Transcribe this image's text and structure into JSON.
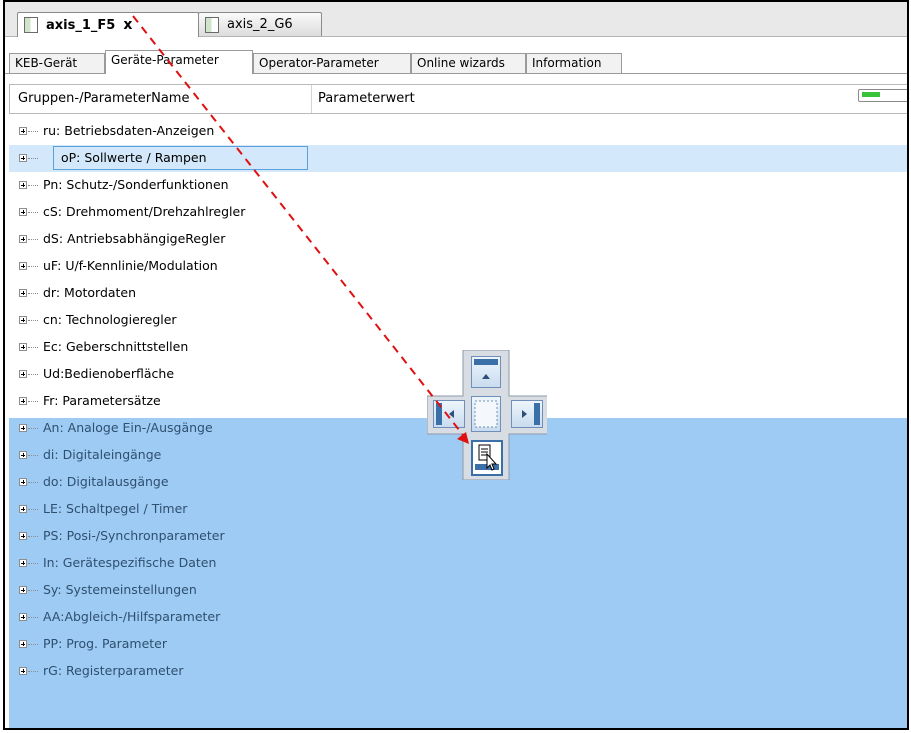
{
  "colors": {
    "accent": "#3a6fa8",
    "selected_row": "#d3e8fa",
    "drop_area": "#9ecbf4",
    "progress": "#39c339",
    "drag_arrow": "#e01010"
  },
  "doc_tabs": [
    {
      "title": "axis_1_F5",
      "close_label": "x",
      "active": true,
      "icon": "device-icon"
    },
    {
      "title": "axis_2_G6",
      "active": false,
      "icon": "device-icon"
    }
  ],
  "param_tabs": [
    "KEB-Gerät",
    "Geräte-Parameter",
    "Operator-Parameter",
    "Online wizards",
    "Information"
  ],
  "grid": {
    "col_name": "Gruppen-/ParameterName",
    "col_value": "Parameterwert",
    "progress_fraction": 0.4,
    "rows": [
      "ru: Betriebsdaten-Anzeigen",
      "oP: Sollwerte / Rampen",
      "Pn: Schutz-/Sonderfunktionen",
      "cS: Drehmoment/Drehzahlregler",
      "dS: AntriebsabhängigeRegler",
      "uF: U/f-Kennlinie/Modulation",
      "dr: Motordaten",
      "cn: Technologieregler",
      "Ec: Geberschnittstellen",
      "Ud:Bedienoberfläche",
      "Fr: Parametersätze",
      "An: Analoge Ein-/Ausgänge",
      "di: Digitaleingänge",
      "do: Digitalausgänge",
      "LE: Schaltpegel / Timer",
      "PS: Posi-/Synchronparameter",
      "In: Gerätespezifische Daten",
      "Sy: Systemeinstellungen",
      "AA:Abgleich-/Hilfsparameter",
      "PP: Prog. Parameter",
      "rG: Registerparameter"
    ]
  },
  "dock_guide": {
    "icons": [
      "dock-top-icon",
      "dock-left-icon",
      "dock-center-icon",
      "dock-right-icon",
      "dock-bottom-icon"
    ],
    "cursor": "drag-cursor-icon"
  }
}
